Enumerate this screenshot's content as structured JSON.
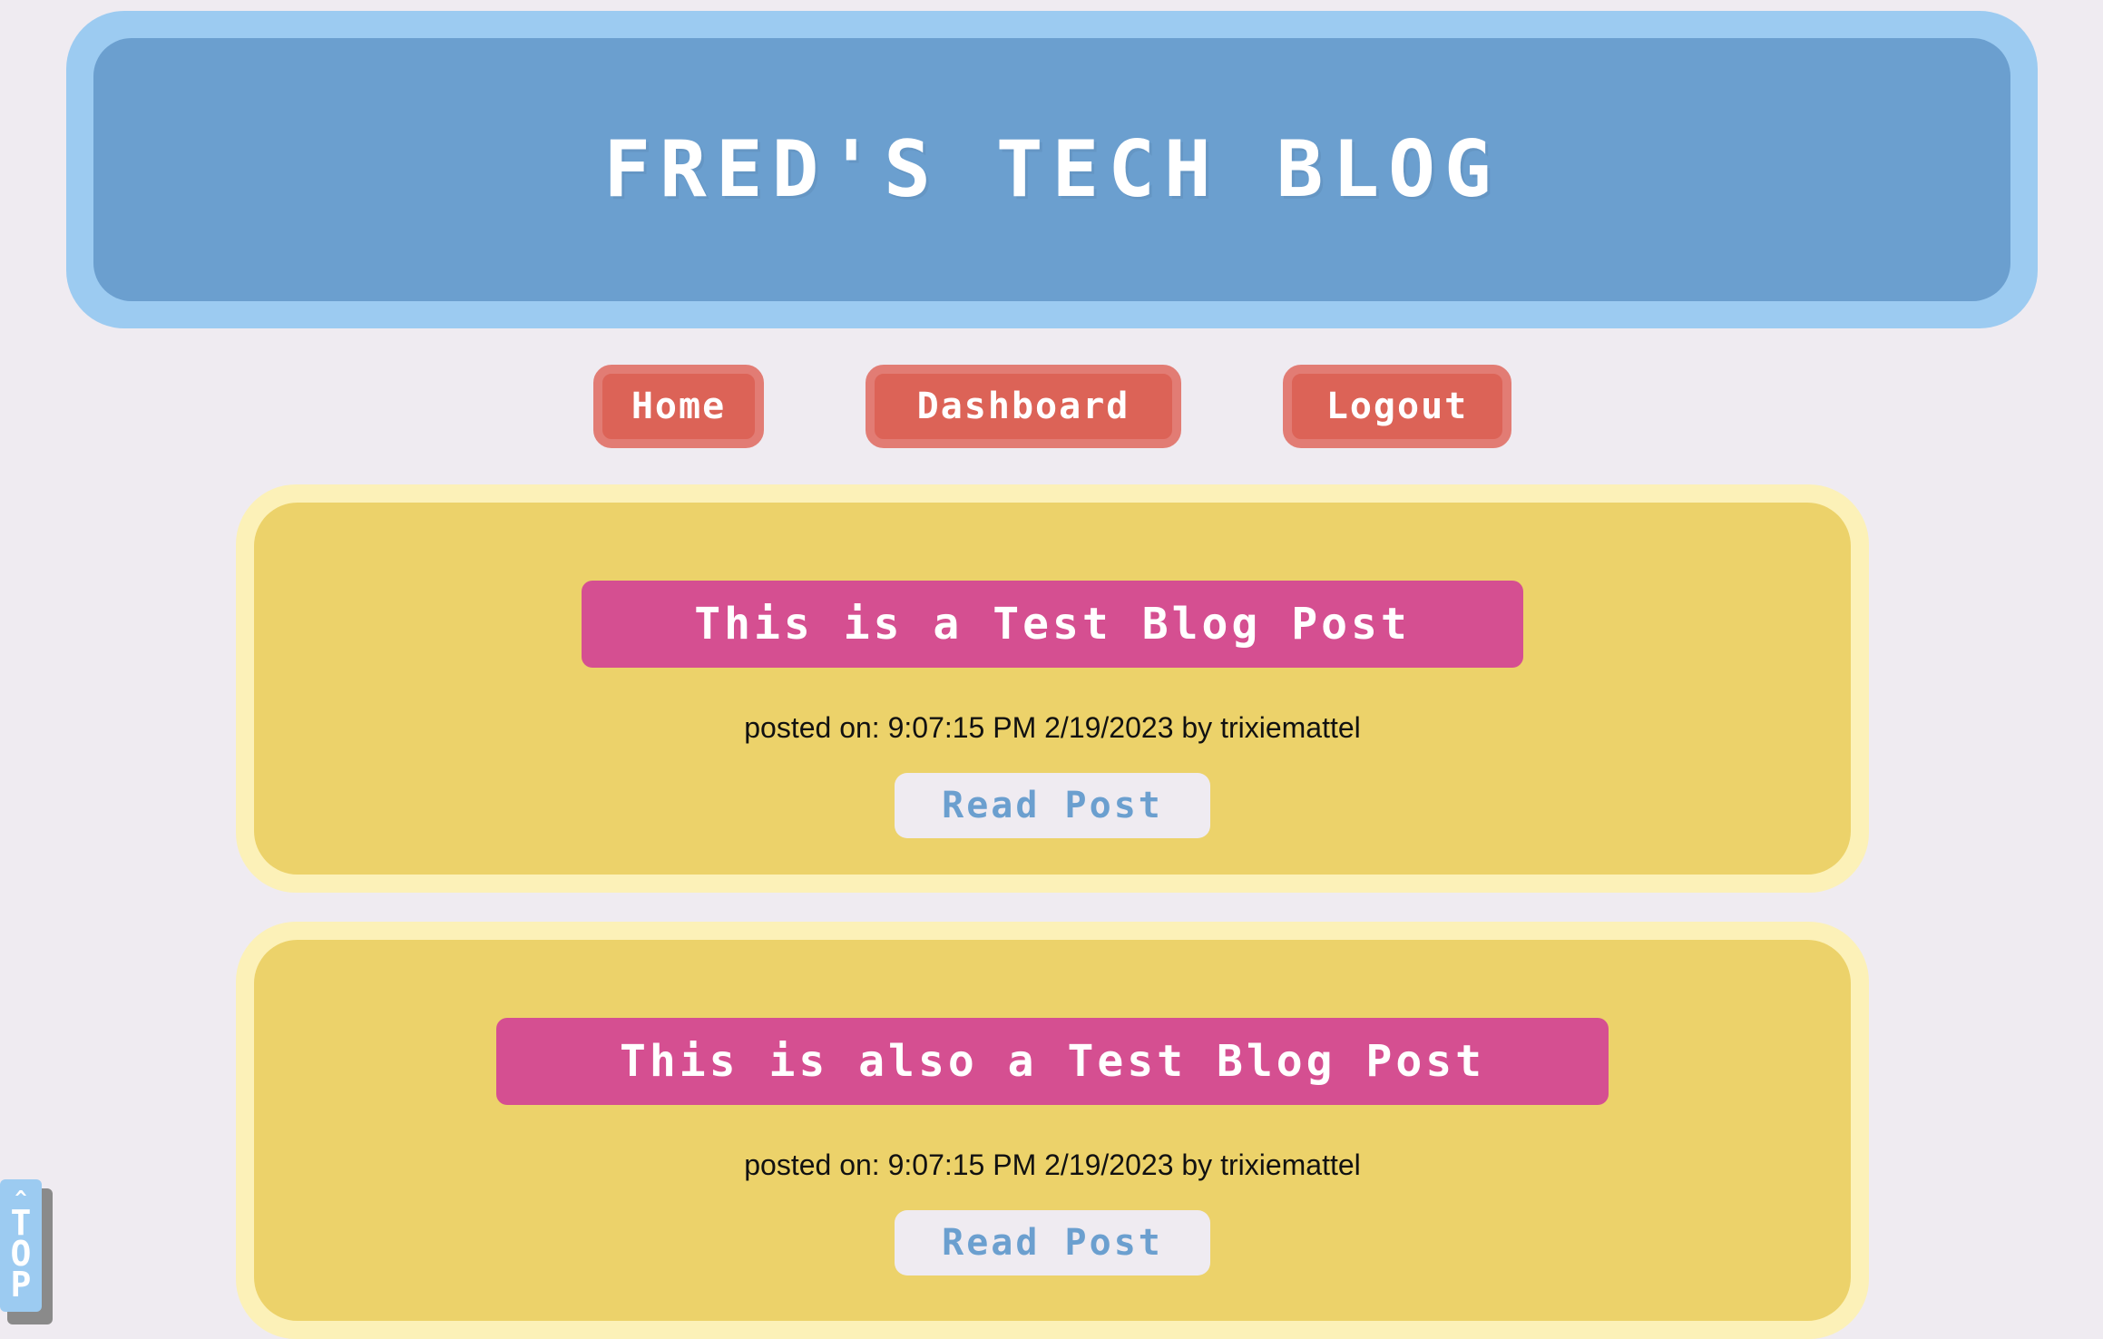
{
  "header": {
    "title": "FRED'S TECH BLOG"
  },
  "nav": {
    "home": "Home",
    "dashboard": "Dashboard",
    "logout": "Logout"
  },
  "posts": [
    {
      "title": "This is a Test Blog Post",
      "meta": "posted on: 9:07:15 PM 2/19/2023 by trixiemattel",
      "read_label": "Read Post"
    },
    {
      "title": "This is also a Test Blog Post",
      "meta": "posted on: 9:07:15 PM 2/19/2023 by trixiemattel",
      "read_label": "Read Post"
    }
  ],
  "top_tab": {
    "caret": "^",
    "letters": [
      "T",
      "O",
      "P"
    ]
  },
  "colors": {
    "background": "#efebf1",
    "header_outer": "#9ccbf1",
    "header_inner": "#6b9fcf",
    "nav_button": "#dc6357",
    "post_outer": "#fcf1b8",
    "post_inner": "#ecd26a",
    "post_title": "#d54f91"
  }
}
